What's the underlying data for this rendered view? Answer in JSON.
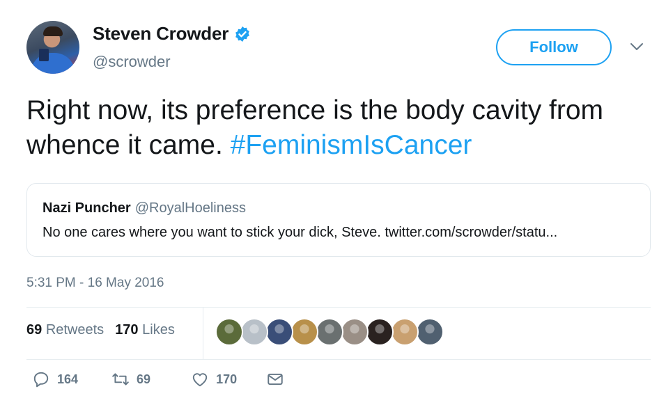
{
  "author": {
    "name": "Steven Crowder",
    "handle": "@scrowder",
    "verified": true
  },
  "follow_label": "Follow",
  "tweet": {
    "text": "Right now, its preference is the body cavity from whence it came. ",
    "hashtag": "#FeminismIsCancer"
  },
  "quote": {
    "name": "Nazi Puncher",
    "handle": "@RoyalHoeliness",
    "text": "No one cares where you want to stick your dick, Steve.  twitter.com/scrowder/statu..."
  },
  "timestamp": "5:31 PM - 16 May 2016",
  "stats": {
    "retweets_count": "69",
    "retweets_label": "Retweets",
    "likes_count": "170",
    "likes_label": "Likes"
  },
  "likers": [
    {
      "color": "#5b6b3a"
    },
    {
      "color": "#b8c0c8"
    },
    {
      "color": "#3a4e78"
    },
    {
      "color": "#b8904a"
    },
    {
      "color": "#6a7070"
    },
    {
      "color": "#9a8f86"
    },
    {
      "color": "#2a2220"
    },
    {
      "color": "#c9a070"
    },
    {
      "color": "#506070"
    }
  ],
  "actions": {
    "reply_count": "164",
    "retweet_count": "69",
    "like_count": "170"
  },
  "colors": {
    "accent": "#1da1f2",
    "secondary_text": "#657786",
    "border": "#e1e8ed"
  }
}
